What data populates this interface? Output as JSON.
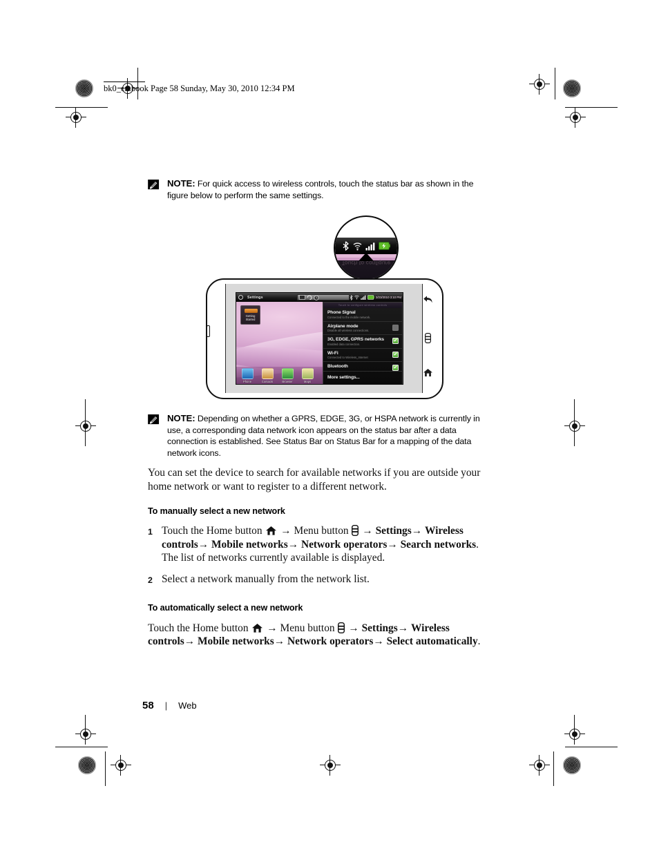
{
  "document": {
    "header": "bk0_en.book  Page 58  Sunday, May 30, 2010  12:34 PM",
    "footer": {
      "page_number": "58",
      "separator": "|",
      "section": "Web"
    }
  },
  "notes": [
    {
      "label": "NOTE:",
      "text": "For quick access to wireless controls, touch the status bar as shown in the figure below to perform the same settings."
    },
    {
      "label": "NOTE:",
      "text": "Depending on whether a GPRS, EDGE, 3G, or HSPA network is currently in use, a corresponding data network icon appears on the status bar after a data connection is established. See Status Bar on Status Bar for a mapping of the data network icons."
    }
  ],
  "figure": {
    "magnifier": {
      "icons": [
        "bluetooth-icon",
        "wifi-icon",
        "signal-bars-icon",
        "battery-charging-icon"
      ],
      "ghost_text": "Touch to configure"
    },
    "device": {
      "status_bar": {
        "app_name": "Settings",
        "timestamp": "3/23/2010 3:10 PM",
        "left_icon": "settings-gear-icon",
        "center_icons": [
          "sd-card-icon",
          "sync-icon",
          "alarm-icon"
        ],
        "right_icons": [
          "bluetooth-icon",
          "wifi-icon",
          "signal-bars-icon",
          "battery-icon"
        ]
      },
      "widget": {
        "label_line1": "Getting",
        "label_line2": "Started"
      },
      "dock": [
        {
          "label": "Phone",
          "icon": "phone-icon"
        },
        {
          "label": "Contacts",
          "icon": "contacts-icon"
        },
        {
          "label": "Browser",
          "icon": "browser-icon"
        },
        {
          "label": "Maps",
          "icon": "maps-icon"
        }
      ],
      "dropdown": {
        "header": "Touch to configure wireless controls",
        "rows": [
          {
            "title": "Phone Signal",
            "subtitle": "Connected to the mobile network.",
            "has_check": false,
            "checked": false
          },
          {
            "title": "Airplane mode",
            "subtitle": "Disable all wireless connections.",
            "has_check": true,
            "checked": false
          },
          {
            "title": "3G, EDGE, GPRS networks",
            "subtitle": "Enabled data connection.",
            "has_check": true,
            "checked": true
          },
          {
            "title": "Wi-Fi",
            "subtitle": "Connected to Wireless_Internet",
            "has_check": true,
            "checked": true
          },
          {
            "title": "Bluetooth",
            "subtitle": "",
            "has_check": true,
            "checked": true
          }
        ],
        "more": "More settings..."
      },
      "hardware_keys": [
        "back-icon",
        "menu-icon",
        "home-icon"
      ]
    }
  },
  "main": {
    "intro": "You can set the device to search for available networks if you are outside your home network or want to register to a different network.",
    "section1": {
      "heading": "To manually select a new network",
      "steps": [
        {
          "number": "1",
          "prefix": "Touch the Home button",
          "home_icon": "home-icon",
          "middle": "Menu button",
          "menu_icon": "menu-icon",
          "path": [
            "Settings",
            "Wireless controls",
            "Mobile networks",
            "Network operators",
            "Search networks"
          ],
          "suffix": "The list of networks currently available is displayed."
        },
        {
          "number": "2",
          "text": "Select a network manually from the network list."
        }
      ]
    },
    "section2": {
      "heading": "To automatically select a new network",
      "instruction": {
        "prefix": "Touch the Home button",
        "home_icon": "home-icon",
        "middle": "Menu button",
        "menu_icon": "menu-icon",
        "path": [
          "Settings",
          "Wireless controls",
          "Mobile networks",
          "Network operators",
          "Select automatically"
        ]
      }
    }
  }
}
